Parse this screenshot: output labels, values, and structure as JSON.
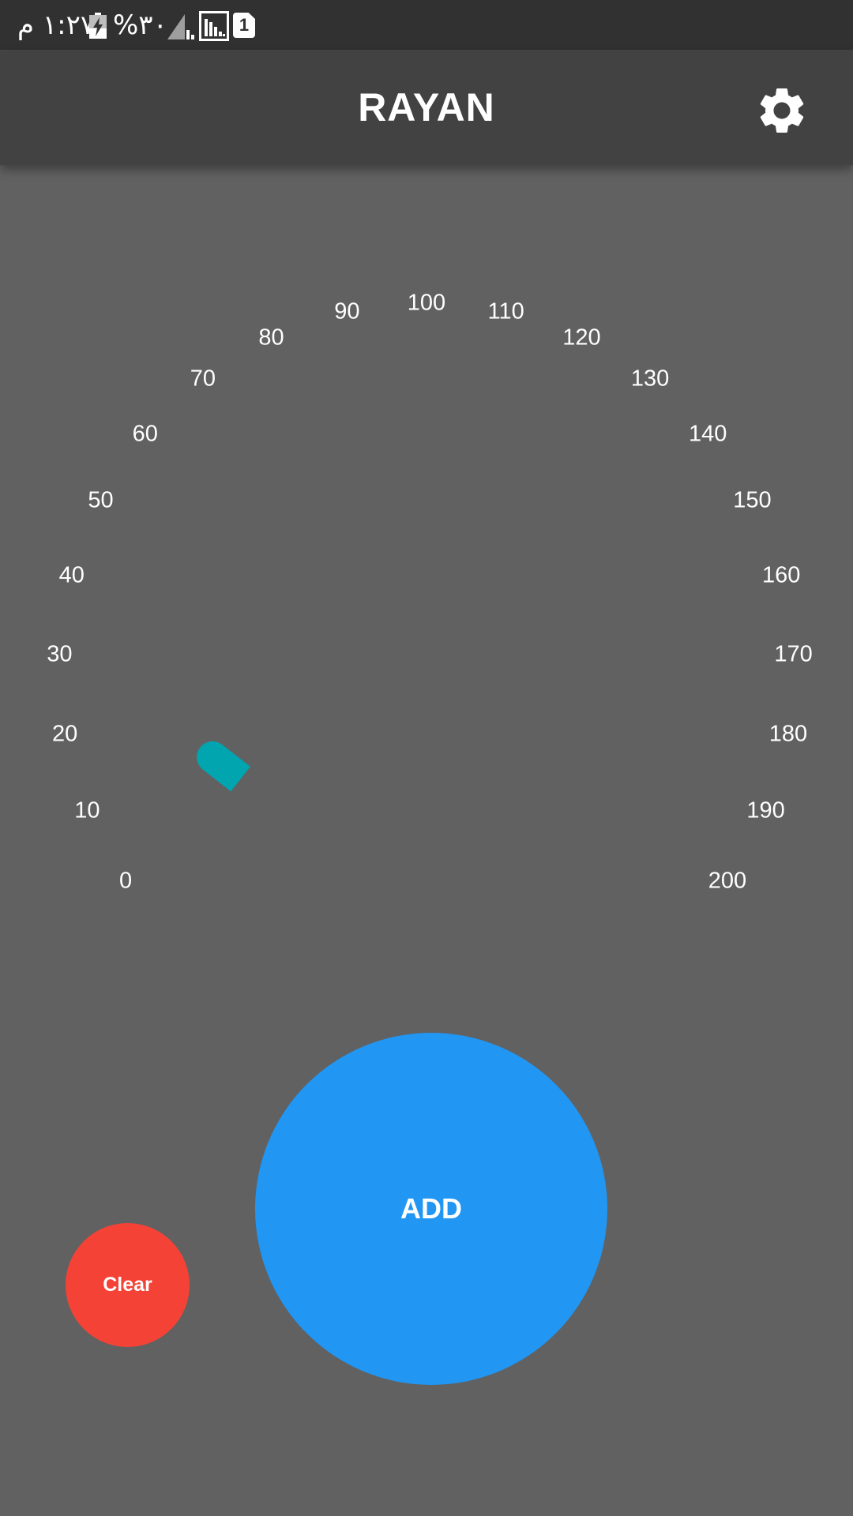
{
  "status_bar": {
    "time": "۱:۲۷ م",
    "battery_percent": "%۳۰",
    "sim_badge": "1",
    "icons": [
      "battery-charging-icon",
      "signal-icon",
      "signal-boxed-icon",
      "sim-icon"
    ]
  },
  "app_bar": {
    "title": "RAYAN",
    "settings_icon": "gear-icon"
  },
  "gauge": {
    "min": 0,
    "max": 200,
    "step": 10,
    "value": 0,
    "ticks": [
      "0",
      "10",
      "20",
      "30",
      "40",
      "50",
      "60",
      "70",
      "80",
      "90",
      "100",
      "110",
      "120",
      "130",
      "140",
      "150",
      "160",
      "170",
      "180",
      "190",
      "200"
    ],
    "needle_color": "#00a5b0"
  },
  "buttons": {
    "add_label": "ADD",
    "clear_label": "Clear"
  },
  "colors": {
    "background": "#616161",
    "app_bar": "#424242",
    "status_bar": "#313131",
    "add": "#2196f3",
    "clear": "#f44336"
  }
}
